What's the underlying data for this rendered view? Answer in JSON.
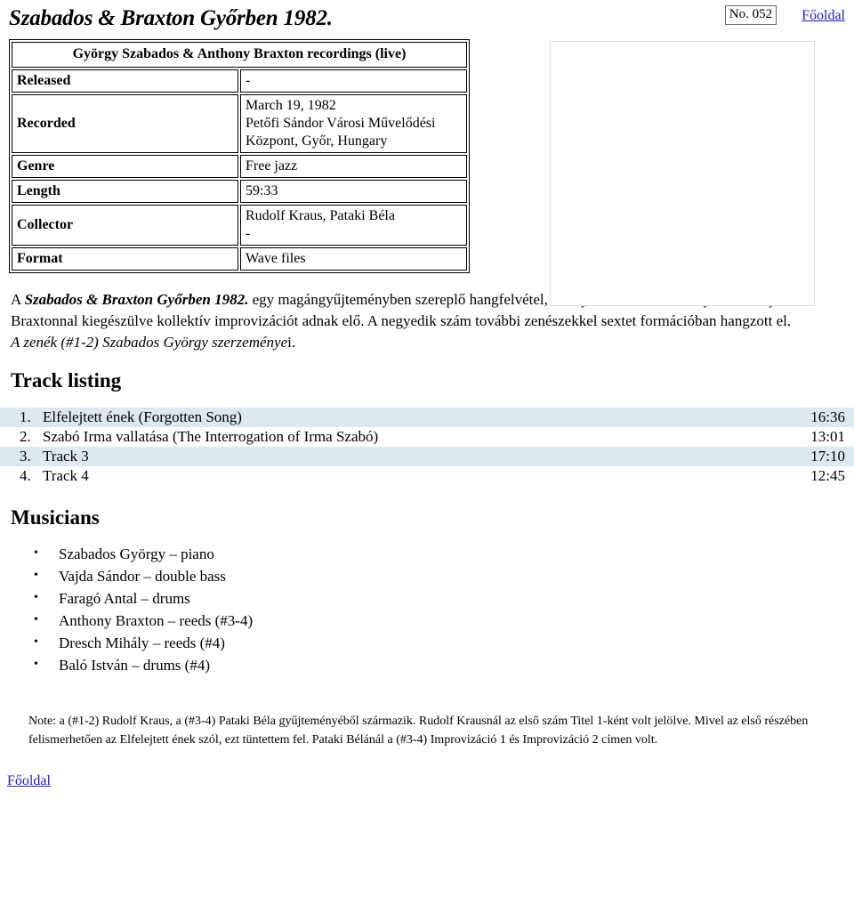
{
  "header": {
    "title": "Szabados & Braxton Győrben 1982.",
    "number_badge": "No. 052",
    "home_link": "Főoldal"
  },
  "info_table": {
    "caption": "György Szabados & Anthony Braxton recordings (live)",
    "rows": [
      {
        "label": "Released",
        "value_line1": "-",
        "value_line2": ""
      },
      {
        "label": "Recorded",
        "value_line1": "March 19, 1982",
        "value_line2": "Petőfi Sándor Városi Művelődési Központ, Győr, Hungary"
      },
      {
        "label": "Genre",
        "value_line1": "Free jazz",
        "value_line2": ""
      },
      {
        "label": "Length",
        "value_line1": "59:33",
        "value_line2": ""
      },
      {
        "label": "Collector",
        "value_line1": "Rudolf Kraus, Pataki Béla",
        "value_line2": "-"
      },
      {
        "label": "Format",
        "value_line1": "Wave files",
        "value_line2": ""
      }
    ]
  },
  "description": {
    "prefix": "A ",
    "title_bold_italic": "Szabados & Braxton Győrben 1982.",
    "body": " egy magángyűjteményben szereplő hangfelvétel, amelyen a Szabados-trió játszik, majd Braxtonnal kiegészülve kollektív improvizációt adnak elő. A negyedik szám további zenészekkel sextet formációban hangzott el.",
    "credit_italic": "A zenék (#1-2) Szabados György szerzeménye",
    "credit_tail": "i."
  },
  "track_section": {
    "heading": "Track listing",
    "tracks": [
      {
        "num": "1.",
        "title": "Elfelejtett ének (Forgotten Song)",
        "time": "16:36"
      },
      {
        "num": "2.",
        "title": "Szabó Irma vallatása (The Interrogation of Irma Szabó)",
        "time": "13:01"
      },
      {
        "num": "3.",
        "title": "Track 3",
        "time": "17:10"
      },
      {
        "num": "4.",
        "title": "Track 4",
        "time": "12:45"
      }
    ]
  },
  "musicians_section": {
    "heading": "Musicians",
    "members": [
      "Szabados György – piano",
      "Vajda Sándor – double bass",
      "Faragó Antal – drums",
      "Anthony Braxton – reeds (#3-4)",
      "Dresch Mihály – reeds (#4)",
      "Baló István – drums (#4)"
    ]
  },
  "note": {
    "text": "Note:  a (#1-2) Rudolf Kraus, a (#3-4) Pataki Béla gyűjteményéből származik. Rudolf Krausnál az első szám Titel 1-ként volt jelölve. Mivel az első részében felismerhetően az Elfelejtett ének szól, ezt tüntettem fel. Pataki Bélánál a (#3-4) Improvizáció 1 és Improvizáció 2 címen volt."
  },
  "footer": {
    "home_link": "Főoldal"
  },
  "colors": {
    "link": "#2222bb",
    "track_alt_row": "#dde9ee",
    "placeholder_border": "#dcdcdc"
  }
}
